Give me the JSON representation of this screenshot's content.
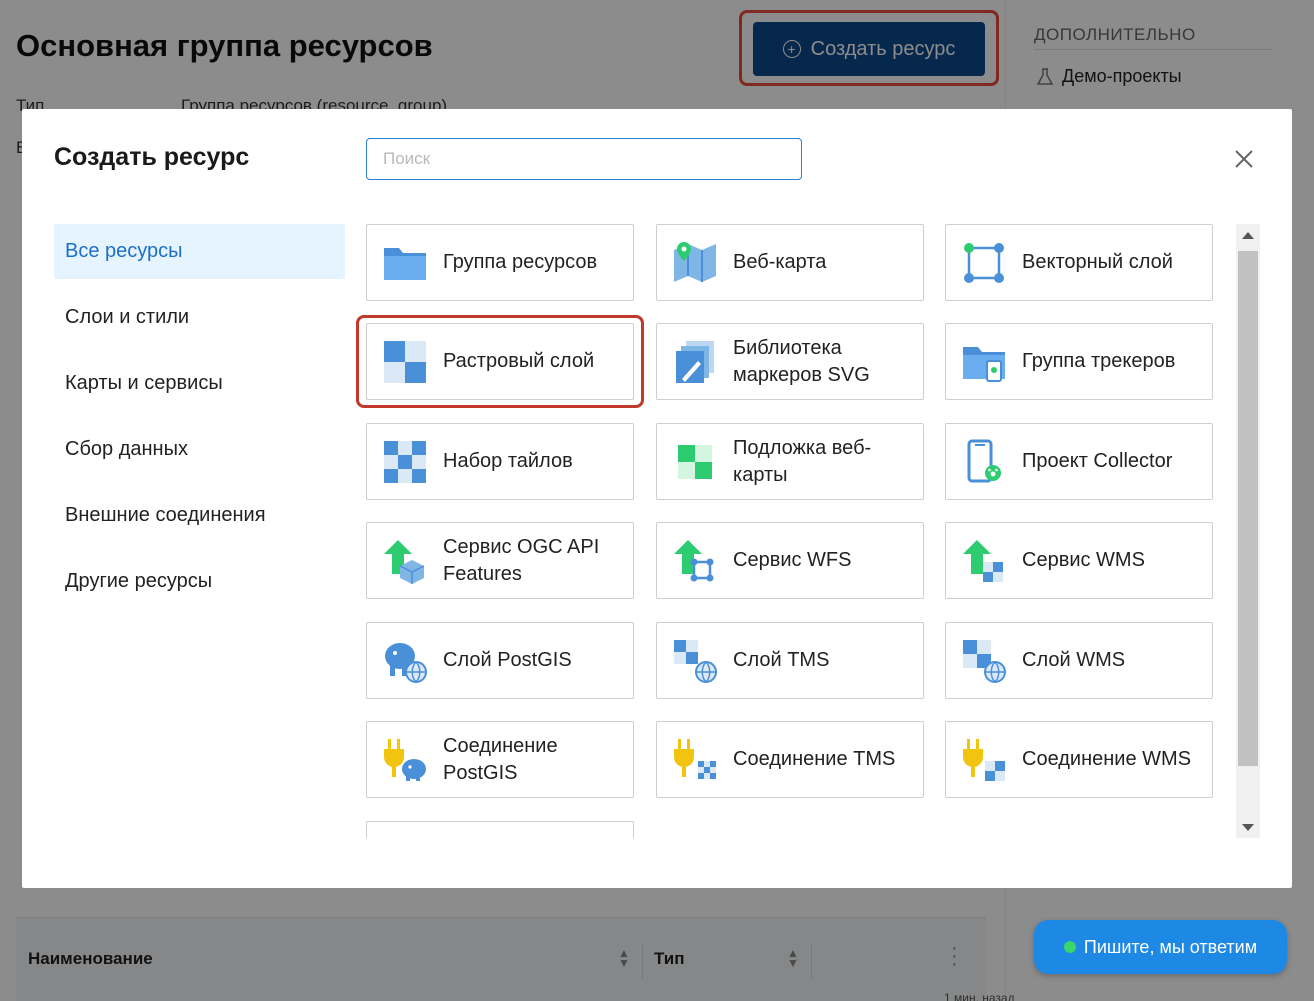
{
  "page": {
    "title": "Основная группа ресурсов",
    "create_button": "Создать ресурс",
    "meta_type_label": "Тип",
    "meta_type_value": "Группа ресурсов (resource_group)",
    "meta_second_label": "В",
    "side_heading": "ДОПОЛНИТЕЛЬНО",
    "side_link": "Демо-проекты",
    "table": {
      "col_name": "Наименование",
      "col_type": "Тип"
    },
    "chat_button": "Пишите, мы ответим",
    "bottom_text": "1 мин. назад"
  },
  "modal": {
    "title": "Создать ресурс",
    "search_placeholder": "Поиск",
    "categories": [
      {
        "label": "Все ресурсы",
        "active": true
      },
      {
        "label": "Слои и стили",
        "active": false
      },
      {
        "label": "Карты и сервисы",
        "active": false
      },
      {
        "label": "Сбор данных",
        "active": false
      },
      {
        "label": "Внешние соединения",
        "active": false
      },
      {
        "label": "Другие ресурсы",
        "active": false
      }
    ],
    "cards": [
      {
        "label": "Группа ресурсов",
        "icon": "folder-icon"
      },
      {
        "label": "Веб-карта",
        "icon": "webmap-icon"
      },
      {
        "label": "Векторный слой",
        "icon": "vector-layer-icon"
      },
      {
        "label": "Растровый слой",
        "icon": "raster-layer-icon"
      },
      {
        "label": "Библиотека маркеров SVG",
        "icon": "svg-marker-library-icon"
      },
      {
        "label": "Группа трекеров",
        "icon": "tracker-group-icon"
      },
      {
        "label": "Набор тайлов",
        "icon": "tileset-icon"
      },
      {
        "label": "Подложка веб-карты",
        "icon": "basemap-icon"
      },
      {
        "label": "Проект Collector",
        "icon": "collector-project-icon"
      },
      {
        "label": "Сервис OGC API Features",
        "icon": "ogc-api-service-icon"
      },
      {
        "label": "Сервис WFS",
        "icon": "wfs-service-icon"
      },
      {
        "label": "Сервис WMS",
        "icon": "wms-service-icon"
      },
      {
        "label": "Слой PostGIS",
        "icon": "postgis-layer-icon"
      },
      {
        "label": "Слой TMS",
        "icon": "tms-layer-icon"
      },
      {
        "label": "Слой WMS",
        "icon": "wms-layer-icon"
      },
      {
        "label": "Соединение PostGIS",
        "icon": "postgis-connection-icon"
      },
      {
        "label": "Соединение TMS",
        "icon": "tms-connection-icon"
      },
      {
        "label": "Соединение WMS",
        "icon": "wms-connection-icon"
      },
      {
        "label": "",
        "icon": "partial-card-icon"
      }
    ],
    "highlighted_card": "Растровый слой"
  },
  "colors": {
    "primary": "#0a4a8a",
    "accent_blue": "#1c6fc9",
    "highlight_red": "#e74c3c",
    "chat_blue": "#1e88e5"
  }
}
